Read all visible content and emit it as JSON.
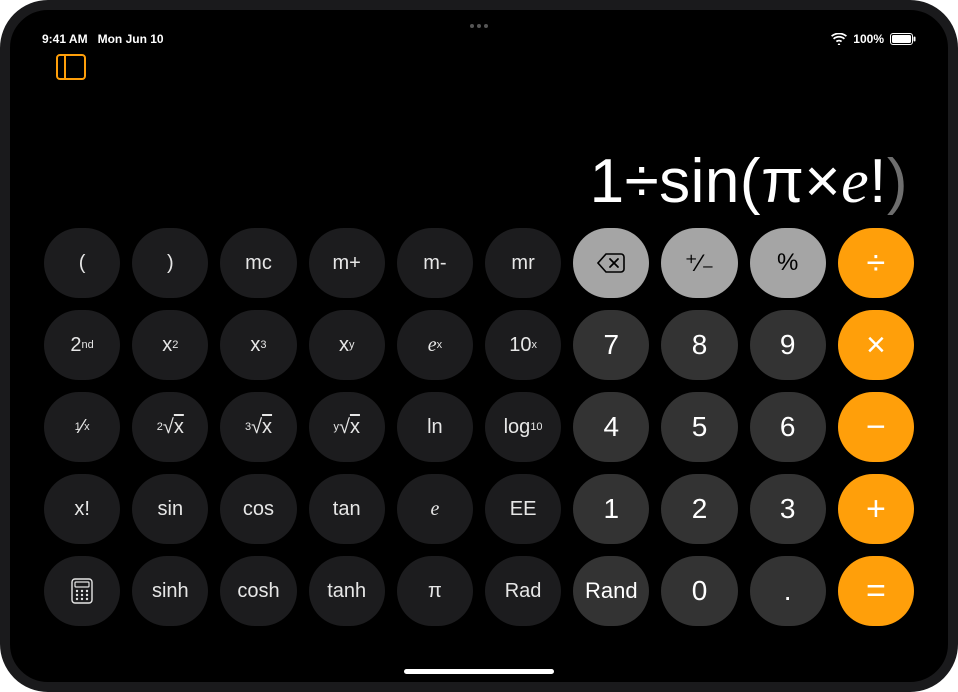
{
  "status": {
    "time": "9:41 AM",
    "date": "Mon Jun 10",
    "battery": "100%"
  },
  "display": {
    "seg1": "1",
    "div": "÷",
    "seg2": "sin",
    "open": "(",
    "pi": "π",
    "mul": "×",
    "e": "e",
    "bang": "!",
    "close": ")"
  },
  "keys": {
    "lparen": "(",
    "rparen": ")",
    "mc": "mc",
    "mplus": "m+",
    "mminus": "m-",
    "mr": "mr",
    "plusminus": "⁺∕₋",
    "percent": "%",
    "divide": "÷",
    "second": "2",
    "second_sup": "nd",
    "x2_base": "x",
    "x2_sup": "2",
    "x3_base": "x",
    "x3_sup": "3",
    "xy_base": "x",
    "xy_sup": "y",
    "ex_base": "e",
    "ex_sup": "x",
    "tenx_base": "10",
    "tenx_sup": "x",
    "n7": "7",
    "n8": "8",
    "n9": "9",
    "multiply": "×",
    "inv_sup": "1",
    "inv_slash": "⁄",
    "inv_sub": "x",
    "sqrt2_sup": "2",
    "sqrt2_rad": "√",
    "sqrt2_x": "x",
    "sqrt3_sup": "3",
    "sqrt3_rad": "√",
    "sqrt3_x": "x",
    "sqrty_sup": "y",
    "sqrty_rad": "√",
    "sqrty_x": "x",
    "ln": "ln",
    "log_base": "log",
    "log_sub": "10",
    "n4": "4",
    "n5": "5",
    "n6": "6",
    "minus": "−",
    "fact": "x!",
    "sin": "sin",
    "cos": "cos",
    "tan": "tan",
    "e": "e",
    "ee": "EE",
    "n1": "1",
    "n2": "2",
    "n3": "3",
    "plus": "+",
    "sinh": "sinh",
    "cosh": "cosh",
    "tanh": "tanh",
    "pi": "π",
    "rad": "Rad",
    "rand": "Rand",
    "n0": "0",
    "dot": ".",
    "equals": "="
  }
}
